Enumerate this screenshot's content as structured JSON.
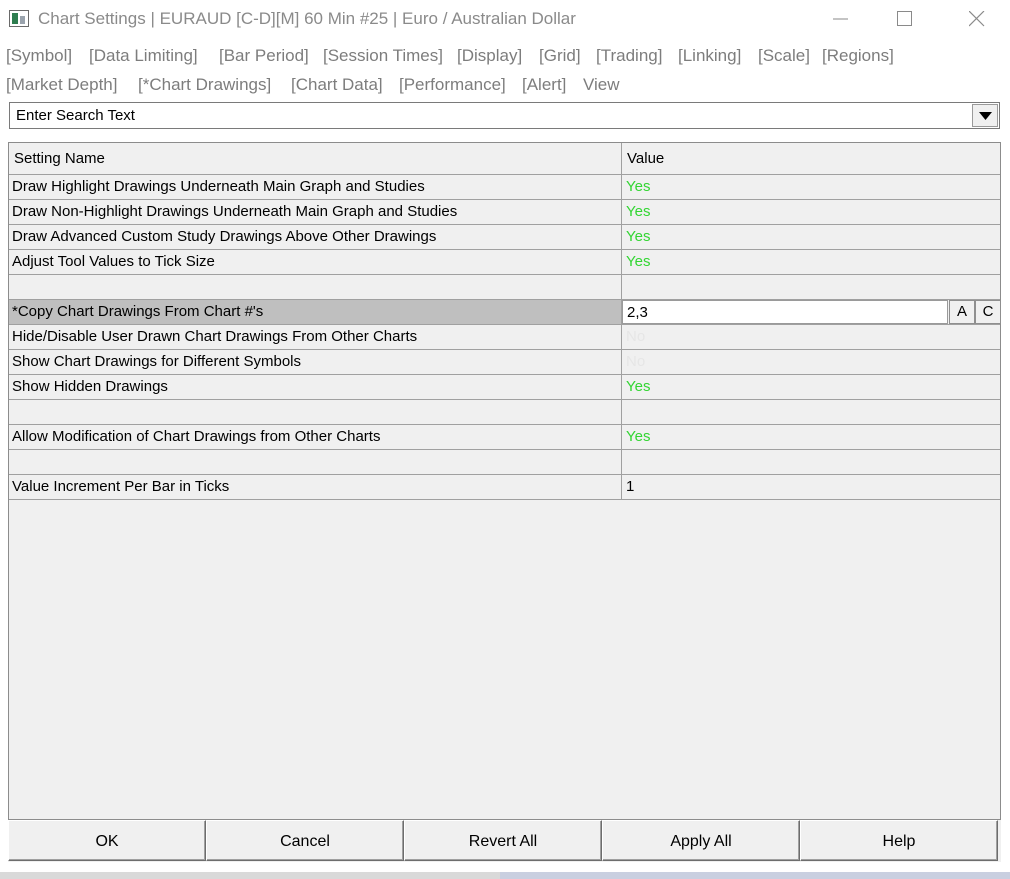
{
  "window": {
    "title": "Chart Settings | EURAUD [C-D][M]  60 Min   #25 | Euro / Australian Dollar"
  },
  "menu": {
    "row1": [
      "[Symbol]",
      "[Data Limiting]",
      "[Bar Period]",
      "[Session Times]",
      "[Display]",
      "[Grid]",
      "[Trading]",
      "[Linking]",
      "[Scale]",
      "[Regions]"
    ],
    "row2": [
      "[Market Depth]",
      "[*Chart Drawings]",
      "[Chart Data]",
      "[Performance]",
      "[Alert]",
      "View"
    ]
  },
  "search": {
    "placeholder": "Enter Search Text"
  },
  "grid": {
    "header": {
      "name": "Setting Name",
      "value": "Value"
    },
    "rows": [
      {
        "name": "Draw Highlight Drawings Underneath Main Graph and Studies",
        "value": "Yes"
      },
      {
        "name": "Draw Non-Highlight Drawings Underneath Main Graph and Studies",
        "value": "Yes"
      },
      {
        "name": "Draw Advanced Custom Study Drawings Above Other Drawings",
        "value": "Yes"
      },
      {
        "name": "Adjust Tool Values to Tick Size",
        "value": "Yes"
      },
      {
        "name": "",
        "value": ""
      },
      {
        "name": "*Copy Chart Drawings From Chart #'s",
        "value": "2,3"
      },
      {
        "name": "Hide/Disable User Drawn Chart Drawings From Other Charts",
        "value": "No"
      },
      {
        "name": "Show Chart Drawings for Different Symbols",
        "value": "No"
      },
      {
        "name": "Show Hidden Drawings",
        "value": "Yes"
      },
      {
        "name": "",
        "value": ""
      },
      {
        "name": "Allow Modification of Chart Drawings from Other Charts",
        "value": "Yes"
      },
      {
        "name": "",
        "value": ""
      },
      {
        "name": "Value Increment Per Bar in Ticks",
        "value": "1"
      }
    ],
    "edit_buttons": {
      "a": "A",
      "c": "C"
    }
  },
  "footer": {
    "ok": "OK",
    "cancel": "Cancel",
    "revert_all": "Revert All",
    "apply_all": "Apply All",
    "help": "Help"
  },
  "colors": {
    "yes": "#33d633",
    "no": "#e6e6e6",
    "selected_row": "#bfbfbf"
  }
}
